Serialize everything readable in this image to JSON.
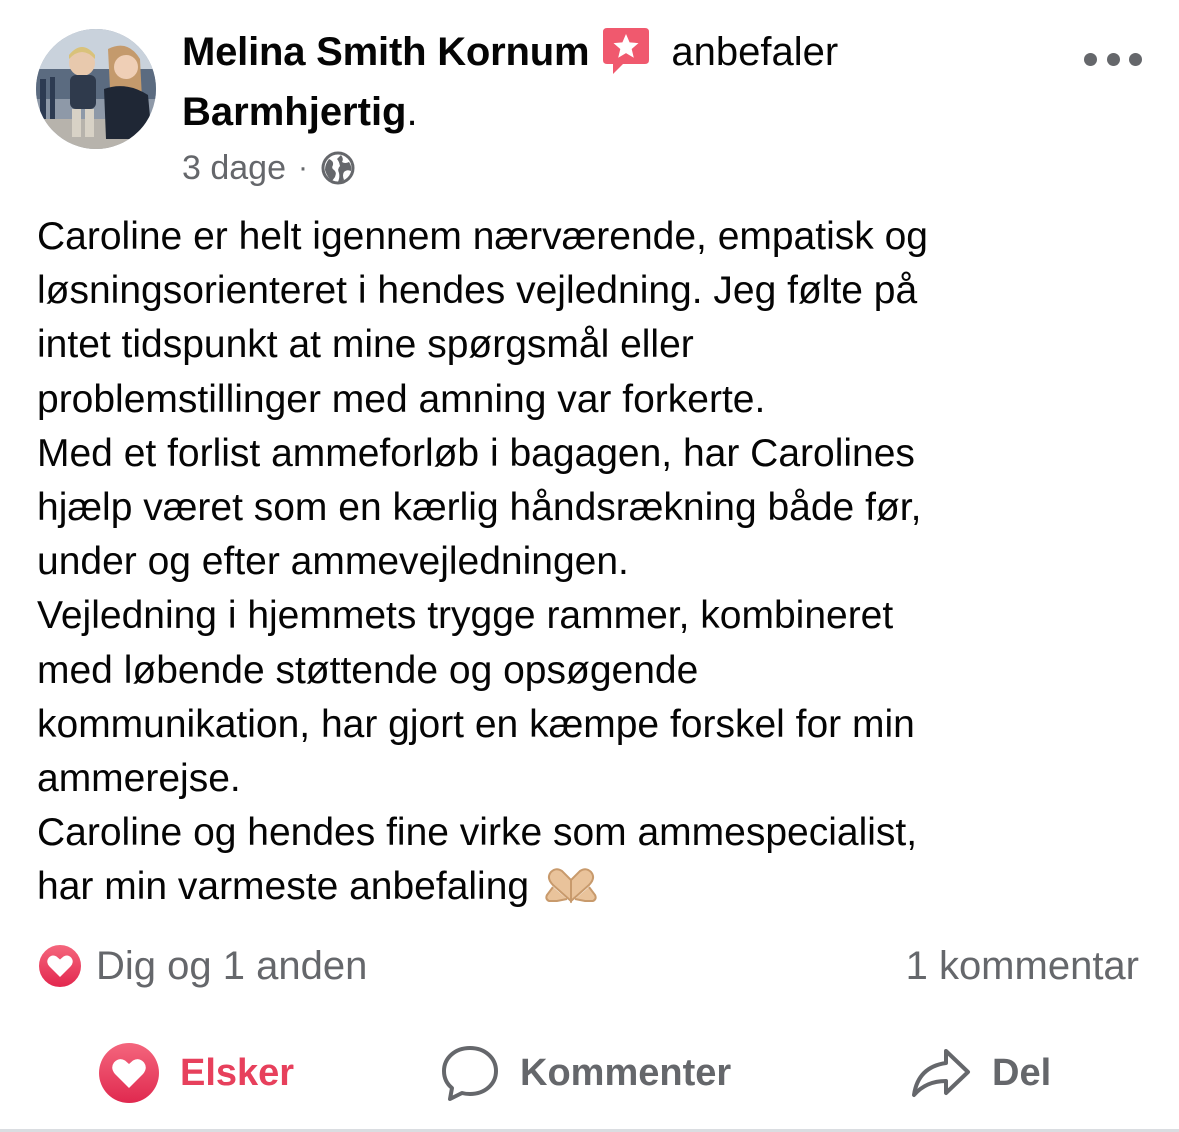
{
  "post": {
    "author": {
      "name": "Melina Smith Kornum",
      "avatar_icon": "profile-photo-avatar"
    },
    "recommendation_badge_icon": "recommendation-star-icon",
    "recommends_text": "anbefaler",
    "page_name": "Barmhjertig",
    "page_suffix": ".",
    "timestamp": "3 dage",
    "meta_separator": "·",
    "privacy_icon": "globe-icon",
    "more_icon": "more-options-icon",
    "body_lines": [
      "Caroline er helt igennem nærværende, empatisk og",
      "løsningsorienteret i hendes vejledning. Jeg følte på",
      "intet tidspunkt at mine spørgsmål eller",
      "problemstillinger med amning var forkerte.",
      "Med et forlist ammeforløb i bagagen, har Carolines",
      "hjælp været som en kærlig håndsrækning både før,",
      "under og efter ammevejledningen.",
      "Vejledning i hjemmets trygge rammer, kombineret",
      "med løbende støttende og opsøgende",
      "kommunikation, har gjort en kæmpe forskel for min",
      "ammerejse.",
      "Caroline og hendes fine virke som ammespecialist,",
      "har min varmeste anbefaling"
    ],
    "body_emoji_icon": "heart-hands-emoji-icon"
  },
  "engagement": {
    "reaction_icon": "love-reaction-icon",
    "reactions_text": "Dig og 1 anden",
    "comments_text": "1 kommentar"
  },
  "actions": {
    "love_label": "Elsker",
    "comment_label": "Kommenter",
    "share_label": "Del"
  },
  "colors": {
    "love": "#e7405c",
    "secondary_text": "#65676b",
    "primary_text": "#050505",
    "badge": "#f0596e"
  }
}
